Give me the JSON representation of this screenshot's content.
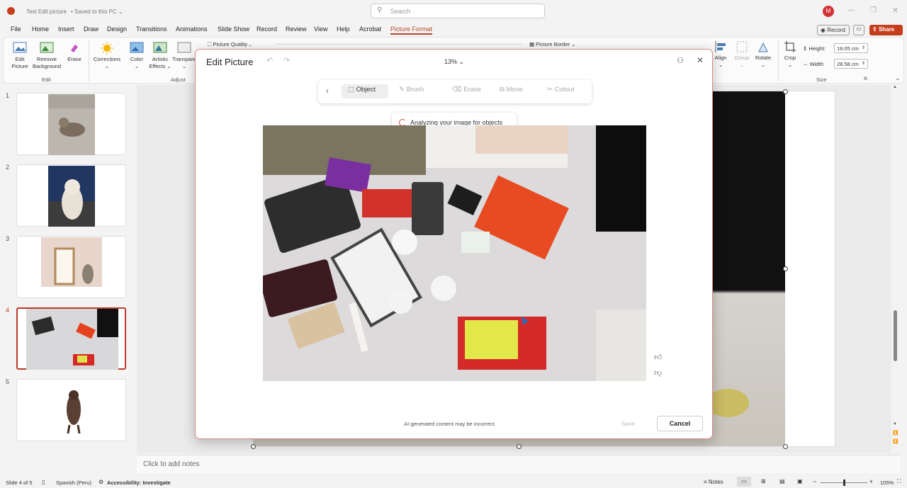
{
  "titlebar": {
    "file_title": "Test Edit picture",
    "save_status": "Saved to this PC",
    "search_placeholder": "Search",
    "avatar_letter": "M"
  },
  "menu": {
    "tabs": [
      "File",
      "Home",
      "Insert",
      "Draw",
      "Design",
      "Transitions",
      "Animations",
      "Slide Show",
      "Record",
      "Review",
      "View",
      "Help",
      "Acrobat",
      "Picture Format"
    ],
    "active_tab": "Picture Format",
    "record_label": "Record",
    "share_label": "Share"
  },
  "ribbon": {
    "edit_picture": [
      "Edit",
      "Picture"
    ],
    "remove_background": [
      "Remove",
      "Background"
    ],
    "erase": "Erase",
    "group_edit": "Edit",
    "corrections": "Corrections",
    "color": "Color",
    "artistic_effects": [
      "Artistic",
      "Effects"
    ],
    "transparency": "Transpare",
    "group_adjust": "Adjust",
    "picture_quality": "Picture Quality",
    "picture_border": "Picture Border",
    "align": "Align",
    "group": "Group",
    "rotate": "Rotate",
    "crop": "Crop",
    "height_label": "Height:",
    "height_value": "19.05 cm",
    "width_label": "Width:",
    "width_value": "28.58 cm",
    "group_size": "Size"
  },
  "slides": {
    "numbers": [
      "1",
      "2",
      "3",
      "4",
      "5"
    ],
    "selected": 4
  },
  "modal": {
    "title": "Edit Picture",
    "zoom": "13%",
    "tools": [
      "Object",
      "Brush",
      "Erase",
      "Move",
      "Cutout"
    ],
    "active_tool": "Object",
    "analyzing_text": "Analyzing your image for objects",
    "disclaimer": "AI-generated content may be incorrect.",
    "save_label": "Save",
    "cancel_label": "Cancel"
  },
  "notes_placeholder": "Click to add notes",
  "status": {
    "slide_of": "Slide 4 of 5",
    "language": "Spanish (Peru)",
    "accessibility": "Accessibility: Investigate",
    "notes_label": "Notes",
    "zoom_level": "105%"
  },
  "colors": {
    "accent": "#b7472a",
    "share_bg": "#c43e1c",
    "selection_border": "#c0392b"
  }
}
